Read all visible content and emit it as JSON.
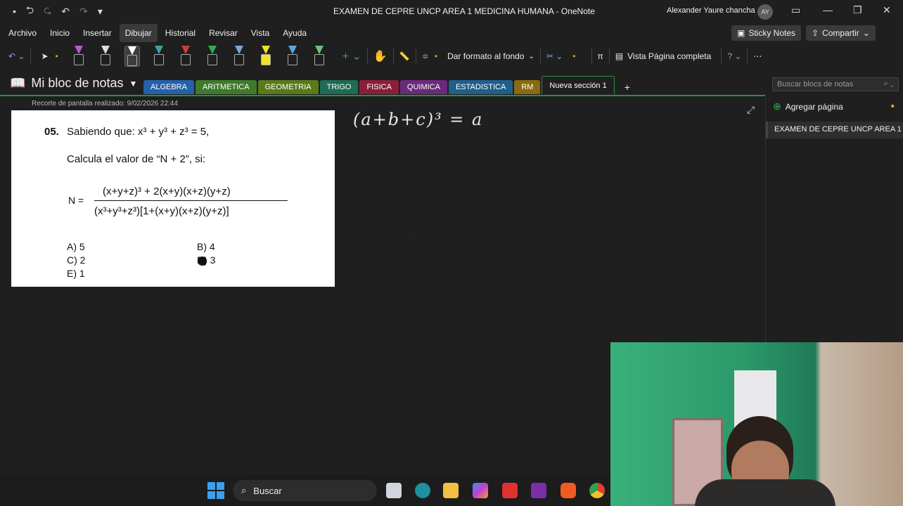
{
  "window": {
    "title": "EXAMEN DE CEPRE UNCP AREA 1 MEDICINA HUMANA  -  OneNote",
    "user": "Alexander Yaure chancha",
    "avatar_initials": "AY"
  },
  "menu": {
    "items": [
      "Archivo",
      "Inicio",
      "Insertar",
      "Dibujar",
      "Historial",
      "Revisar",
      "Vista",
      "Ayuda"
    ],
    "sticky_notes": "Sticky Notes",
    "share": "Compartir"
  },
  "ribbon": {
    "format_background": "Dar formato al fondo",
    "full_page_view": "Vista Página completa",
    "pen_colors": [
      "#b45cc8",
      "#dddddd",
      "#ffffff",
      "#3aa0a8",
      "#d23a3a",
      "#2fae4e",
      "#7aa7d6",
      "#f2e12a",
      "#5aa7e0",
      "#72c27a"
    ]
  },
  "notebook": {
    "name": "Mi bloc de notas",
    "sections": [
      {
        "label": "ALGEBRA",
        "color": "#2461a8"
      },
      {
        "label": "ARITMETICA",
        "color": "#3f7a2a"
      },
      {
        "label": "GEOMETRIA",
        "color": "#5a7a1a"
      },
      {
        "label": "TRIGO",
        "color": "#1f6b55"
      },
      {
        "label": "FISICA",
        "color": "#8a1f3a"
      },
      {
        "label": "QUIMICA",
        "color": "#6a2a7a"
      },
      {
        "label": "ESTADISTICA",
        "color": "#1f5f8a"
      },
      {
        "label": "RM",
        "color": "#8a6a10"
      },
      {
        "label": "Nueva sección 1",
        "color": "#1f1f1f"
      }
    ],
    "search_placeholder": "Buscar blocs de notas"
  },
  "page": {
    "clip_caption": "Recorte de pantalla realizado: 9/02/2026 22:44",
    "problem_number": "05.",
    "given": "Sabiendo que: x³ + y³ + z³ = 5,",
    "ask": "Calcula el valor de “N + 2”, si:",
    "n_label": "N =",
    "numerator": "(x+y+z)³ + 2(x+y)(x+z)(y+z)",
    "denominator": "(x³+y³+z³)[1+(x+y)(x+z)(y+z)]",
    "options": [
      "A) 5",
      "B) 4",
      "C) 2",
      "D) 3",
      "E) 1"
    ],
    "handwriting": "(a+b+c)³ = a"
  },
  "sidebar": {
    "add_page": "Agregar página",
    "pages": [
      "EXAMEN DE CEPRE UNCP AREA 1"
    ]
  },
  "taskbar": {
    "search_label": "Buscar"
  }
}
